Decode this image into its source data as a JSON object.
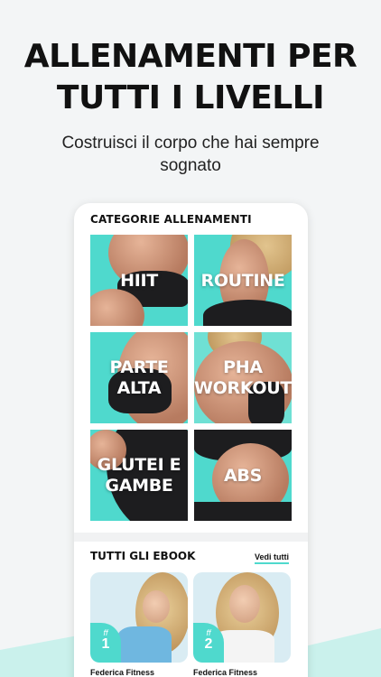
{
  "headline": {
    "line1": "ALLENAMENTI PER",
    "line2": "TUTTI I LIVELLI"
  },
  "subtitle": {
    "line1": "Costruisci il corpo che hai sempre",
    "line2": "sognato"
  },
  "categories": {
    "title": "CATEGORIE ALLENAMENTI",
    "tiles": [
      {
        "label": "HIIT"
      },
      {
        "label": "ROUTINE"
      },
      {
        "label": "PARTE\nALTA"
      },
      {
        "label": "PHA\nWORKOUT"
      },
      {
        "label": "GLUTEI E\nGAMBE"
      },
      {
        "label": "ABS"
      }
    ]
  },
  "ebooks": {
    "title": "TUTTI GLI EBOOK",
    "see_all": "Vedi tutti",
    "items": [
      {
        "badge_logo": "ff",
        "number": "1",
        "author": "Federica Fitness"
      },
      {
        "badge_logo": "ff",
        "number": "2",
        "author": "Federica Fitness"
      }
    ]
  },
  "colors": {
    "accent": "#4fd9cd",
    "background": "#f3f5f6",
    "text": "#111111"
  }
}
